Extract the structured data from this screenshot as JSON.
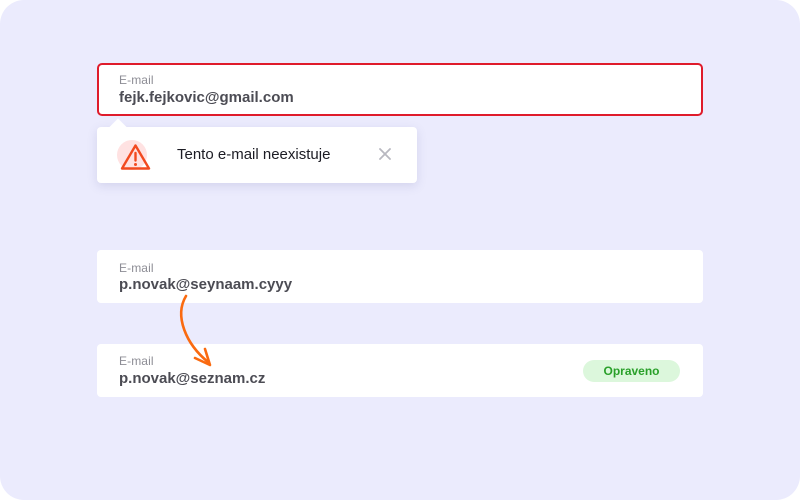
{
  "error_field": {
    "label": "E-mail",
    "value": "fejk.fejkovic@gmail.com"
  },
  "tooltip": {
    "message": "Tento e-mail neexistuje",
    "icon": "warning-triangle-icon",
    "close_icon": "close-icon"
  },
  "invalid_field": {
    "label": "E-mail",
    "value": "p.novak@seynaam.cyyy"
  },
  "corrected_field": {
    "label": "E-mail",
    "value": "p.novak@seznam.cz",
    "badge": "Opraveno"
  },
  "colors": {
    "background": "#ebebfd",
    "error": "#df1b2b",
    "warning_icon": "#f24a20",
    "arrow": "#fa6a10",
    "badge_bg": "#dcf7dc",
    "badge_text": "#2aa02a"
  }
}
